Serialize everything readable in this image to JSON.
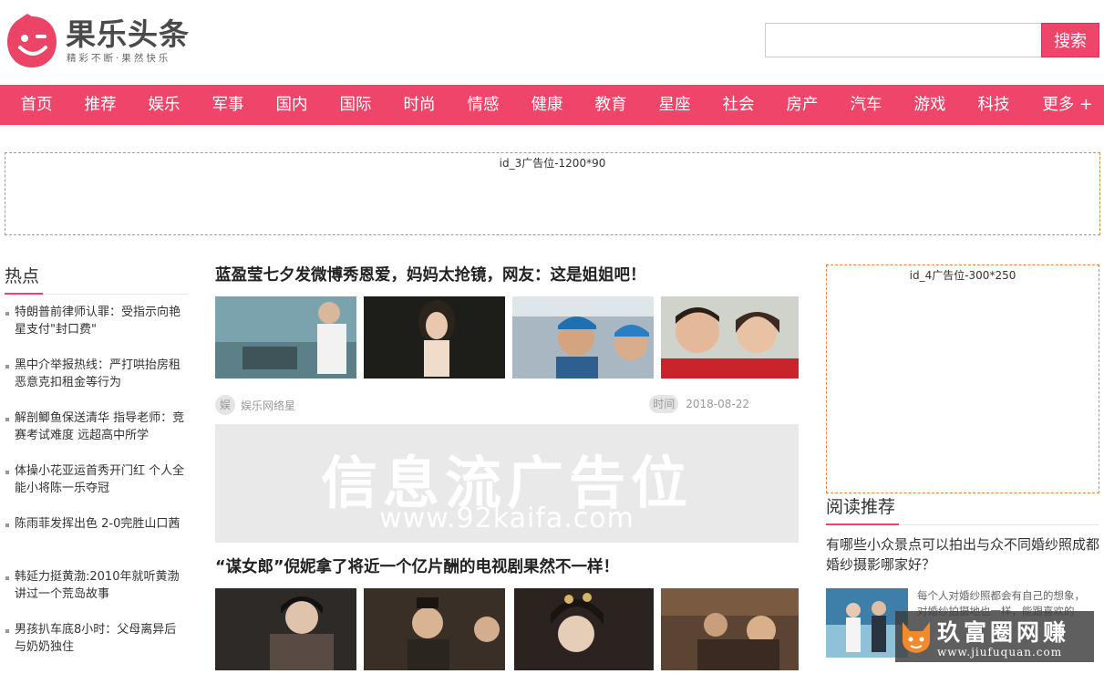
{
  "header": {
    "logo_title": "果乐头条",
    "logo_sub": "精彩不断·果然快乐",
    "search_value": "",
    "search_button": "搜索"
  },
  "nav": [
    "首页",
    "推荐",
    "娱乐",
    "军事",
    "国内",
    "国际",
    "时尚",
    "情感",
    "健康",
    "教育",
    "星座",
    "社会",
    "房产",
    "汽车",
    "游戏",
    "科技",
    "更多 +"
  ],
  "ads": {
    "top_banner": "id_3广告位-1200*90",
    "right_box": "id_4广告位-300*250",
    "feed_main": "信息流广告位",
    "feed_url": "www.92kaifa.com"
  },
  "hot": {
    "title": "热点",
    "items": [
      "特朗普前律师认罪：受指示向艳星支付\"封口费\"",
      "黑中介举报热线：严打哄抬房租恶意克扣租金等行为",
      "解剖鲫鱼保送清华 指导老师：竞赛考试难度 远超高中所学",
      "体操小花亚运首秀开门红 个人全能小将陈一乐夺冠",
      "陈雨菲发挥出色 2-0完胜山口茜",
      "韩延力挺黄渤:2010年就听黄渤讲过一个荒岛故事",
      "男孩扒车底8小时：父母离异后与奶奶独住"
    ]
  },
  "articles": [
    {
      "title": "蓝盈莹七夕发微博秀恩爱，妈妈太抢镜，网友：这是姐姐吧！",
      "source_badge": "娱",
      "source": "娱乐网络星",
      "time_label": "时间",
      "date": "2018-08-22"
    },
    {
      "title": "“谋女郎”倪妮拿了将近一个亿片酬的电视剧果然不一样！"
    }
  ],
  "recommend": {
    "title": "阅读推荐",
    "question": "有哪些小众景点可以拍出与众不同婚纱照成都婚纱摄影哪家好？",
    "snippet": "每个人对婚纱照都会有自己的想象，对婚纱拍摄地也一样，能跟喜欢的"
  },
  "watermark": {
    "title": "玖富圈网赚",
    "url": "www.jiufuquan.com"
  },
  "colors": {
    "brand": "#f0456a",
    "ad_border": "#e8863a"
  }
}
